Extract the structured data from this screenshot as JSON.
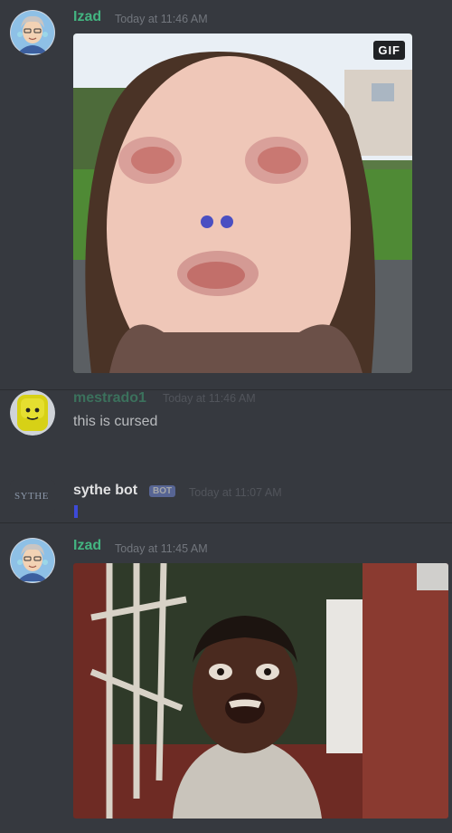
{
  "messages": [
    {
      "username": "Izad",
      "timestamp": "Today at 11:46 AM",
      "username_color": "#43b581",
      "attachment_badge": "GIF"
    },
    {
      "username": "mestrado1",
      "timestamp": "Today at 11:46 AM",
      "username_color": "#43b581",
      "content": "this is cursed"
    },
    {
      "username": "sythe bot",
      "bot_tag": "BOT",
      "timestamp": "Today at 11:07 AM",
      "avatar_text": "SYTHE",
      "username_color": "#ffffff"
    },
    {
      "username": "Izad",
      "timestamp": "Today at 11:45 AM",
      "username_color": "#43b581"
    }
  ],
  "theme": {
    "background": "#36393f",
    "accent_green": "#43b581",
    "timestamp_color": "#72767d",
    "bot_tag_color": "#7289da"
  }
}
